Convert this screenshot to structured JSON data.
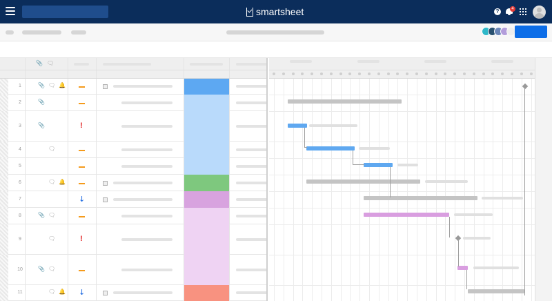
{
  "app": {
    "logo_text": "smartsheet",
    "help_icon": "help-icon",
    "notification_count": "4",
    "avatar_icon": "user-avatar"
  },
  "colors": {
    "topbar": "#0b2d5b",
    "accent": "#0d6ee8",
    "bar_blue": "#5fa8f0",
    "bar_grey": "#c4c4c4",
    "bar_purple": "#d99ee0",
    "status_orange": "#f59b1c",
    "status_red": "#e02020",
    "status_blue": "#1565e0",
    "cell_blue_dark": "#5da8f2",
    "cell_blue_light": "#b9dafb",
    "cell_green": "#7ec87e",
    "cell_purple_dark": "#d8a3df",
    "cell_purple_light": "#efd3f3",
    "cell_salmon": "#f89280"
  },
  "rows": [
    {
      "num": "1",
      "attach": true,
      "comment": true,
      "bell": true,
      "status": "dash",
      "expand": "minus",
      "cell_color": "#5da8f2"
    },
    {
      "num": "2",
      "attach": true,
      "comment": false,
      "bell": false,
      "status": "dash",
      "expand": "",
      "cell_color": "#b9dafb"
    },
    {
      "num": "3",
      "attach": true,
      "comment": false,
      "bell": false,
      "status": "excl",
      "expand": "",
      "cell_color": "#b9dafb"
    },
    {
      "num": "4",
      "attach": false,
      "comment": true,
      "bell": false,
      "status": "dash",
      "expand": "",
      "cell_color": "#b9dafb"
    },
    {
      "num": "5",
      "attach": false,
      "comment": false,
      "bell": false,
      "status": "dash",
      "expand": "",
      "cell_color": "#b9dafb"
    },
    {
      "num": "6",
      "attach": false,
      "comment": true,
      "bell": true,
      "status": "dash",
      "expand": "plus",
      "cell_color": "#7ec87e"
    },
    {
      "num": "7",
      "attach": false,
      "comment": false,
      "bell": false,
      "status": "arrow",
      "expand": "minus",
      "cell_color": "#d8a3df"
    },
    {
      "num": "8",
      "attach": true,
      "comment": true,
      "bell": false,
      "status": "dash",
      "expand": "",
      "cell_color": "#efd3f3"
    },
    {
      "num": "9",
      "attach": false,
      "comment": true,
      "bell": false,
      "status": "excl",
      "expand": "",
      "cell_color": "#efd3f3"
    },
    {
      "num": "10",
      "attach": true,
      "comment": true,
      "bell": false,
      "status": "dash",
      "expand": "",
      "cell_color": "#efd3f3"
    },
    {
      "num": "11",
      "attach": false,
      "comment": true,
      "bell": true,
      "status": "arrow",
      "expand": "plus",
      "cell_color": "#f89280"
    }
  ],
  "status_glyphs": {
    "excl": "!",
    "arrow": "↓"
  }
}
